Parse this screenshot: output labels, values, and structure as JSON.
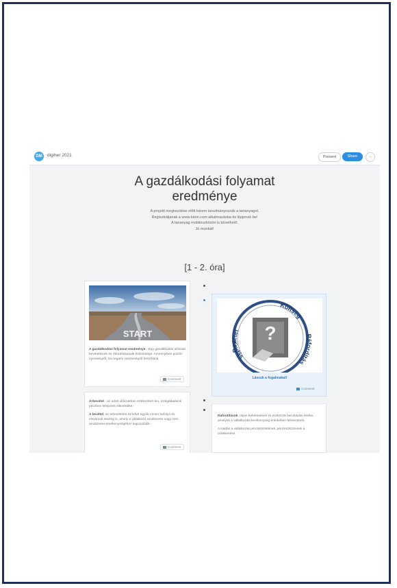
{
  "app": {
    "logo_text": "DM",
    "brand": "digiher 2021"
  },
  "toolbar": {
    "present_label": "Present",
    "share_label": "Share",
    "more_label": "..."
  },
  "page": {
    "title_line1": "A gazdálkodási folyamat",
    "title_line2": "eredménye",
    "intro": [
      "A projekt megkezdése előtt kérem tanulmányozzák a tananyagot.",
      "Regisztráljanak a www.tutori.com alkalmazásba és lépjenek be!",
      "A tananyag mobileszközön is követhető.",
      "Jó munkát!"
    ],
    "section": "[1 - 2. óra]"
  },
  "cards": {
    "c1": {
      "image_word": "START",
      "text_bold": "A gazdálkodási folyamat eredménye",
      "text_rest": " - Egy gazdálkodás időszak bevételeinek és ráfordításainak különbsége. Amennyiben pozitív nyereségről, ha negatív veszteségről beszélünk.",
      "comment": "Comment"
    },
    "c2": {
      "arc_words": [
        "Bevétel",
        "Költség",
        "Ráfordítás",
        "Kiadás"
      ],
      "question": "?",
      "caption": "Lássuk a fogalmakat!",
      "comment": "Comment"
    },
    "c3": {
      "p1_bold": "Árbevétel",
      "p1_rest": " - az adott időszakban értékesített áru, szolgáltatások pénzben kifejezett ellenértéke.",
      "p2_bold": "A bevétel",
      "p2_rest": ", az árbevételen túl lehet egyéb címen befolyó és elszámolt összeg is, amely a vállalkozó rendszeres vagy nem rendszeres tevékenységéhez kapcsolódik.",
      "comment": "Comment"
    },
    "c4": {
      "p1_bold": "Ráfordítások",
      "p1_rest": ", olyan befektetések és eszközök beruházási értéke, amelyek a vállalkozási tevékenység érdekében felmerülnek.",
      "p2": "A kiadás  a vállalkozás pénzkészletének, pénzeszközeinek a csökkenése."
    }
  },
  "colors": {
    "frame": "#1f2f55",
    "accent": "#2d8fe3",
    "highlight_card": "#e9f2fb"
  }
}
